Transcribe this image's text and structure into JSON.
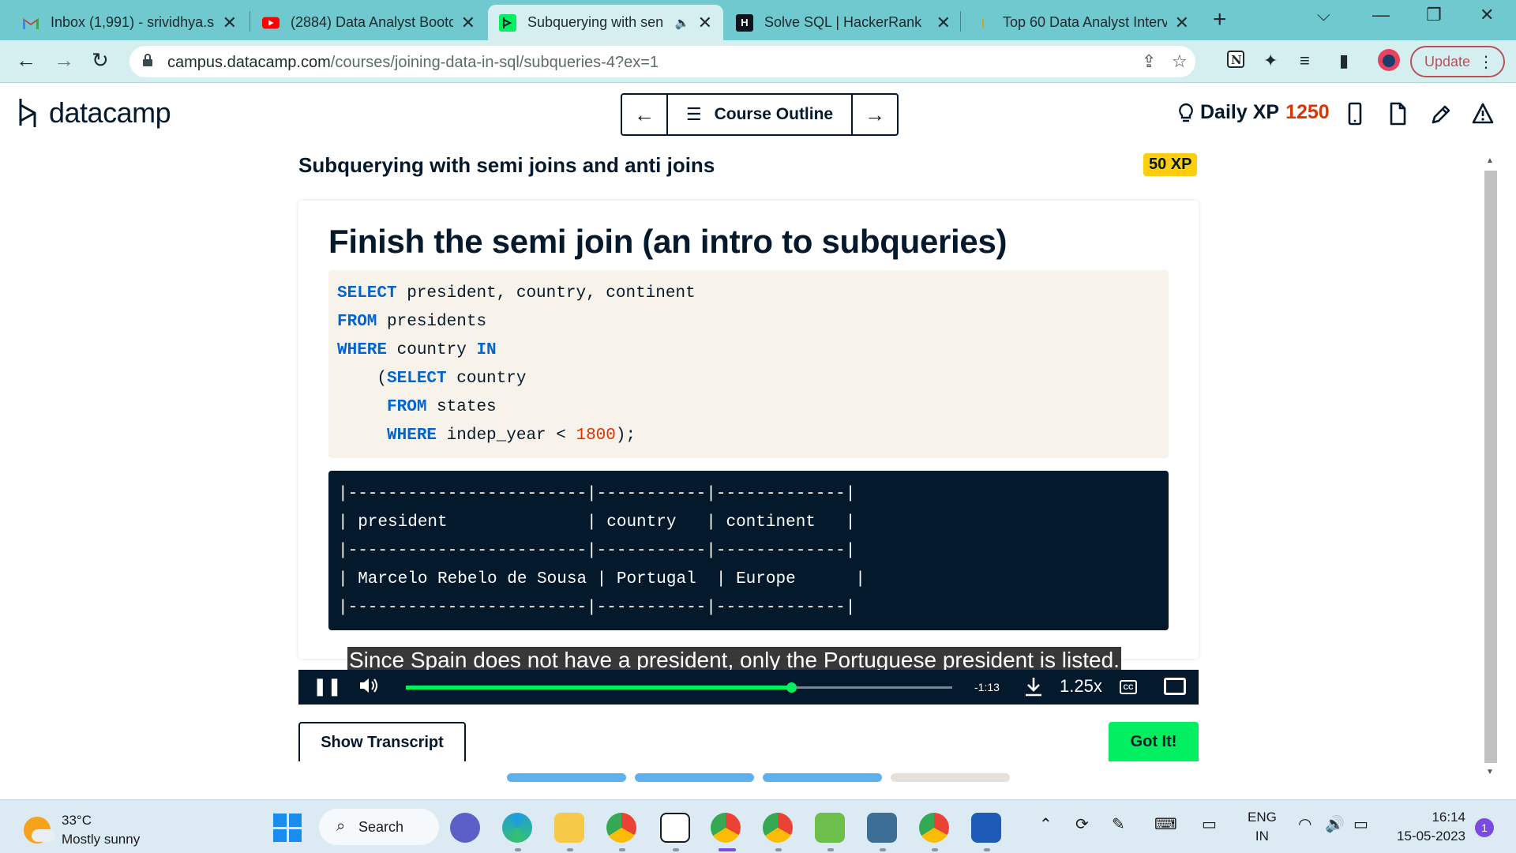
{
  "browser": {
    "tabs": [
      {
        "title": "Inbox (1,991) - srividhya.s",
        "icon": "gmail-icon"
      },
      {
        "title": "(2884) Data Analyst Bootc",
        "icon": "youtube-icon"
      },
      {
        "title": "Subquerying with sen",
        "icon": "datacamp-icon",
        "active": true
      },
      {
        "title": "Solve SQL | HackerRank",
        "icon": "hackerrank-icon"
      },
      {
        "title": "Top 60 Data Analyst Interv",
        "icon": "page-icon"
      }
    ],
    "url_host": "campus.datacamp.com",
    "url_path": "/courses/joining-data-in-sql/subqueries-4?ex=1",
    "update_label": "Update"
  },
  "app": {
    "logo_text": "datacamp",
    "course_outline_label": "Course Outline",
    "daily_xp_label": "Daily XP",
    "daily_xp_value": "1250",
    "lesson_title": "Subquerying with semi joins and anti joins",
    "xp_badge": "50 XP",
    "slide_title": "Finish the semi join (an intro to subqueries)",
    "caption": "Since Spain does not have a president, only the Portuguese president is listed.",
    "result_lines": [
      "|------------------------|-----------|-------------|",
      "| president              | country   | continent   |",
      "|------------------------|-----------|-------------|",
      "| Marcelo Rebelo de Sousa | Portugal  | Europe      |",
      "|------------------------|-----------|-------------|"
    ],
    "player": {
      "time_remaining": "-1:13",
      "playback_rate": "1.25x",
      "cc_label": "CC",
      "progress": 0.705
    },
    "show_transcript_label": "Show Transcript",
    "got_it_label": "Got It!",
    "progress_dots": [
      true,
      true,
      true,
      false
    ],
    "colors": {
      "accent_green": "#03ef62",
      "navy": "#05192d",
      "xp_orange": "#dd3400",
      "badge_yellow": "#fcce0d"
    }
  },
  "taskbar": {
    "temperature": "33°C",
    "weather": "Mostly sunny",
    "search_label": "Search",
    "lang_line1": "ENG",
    "lang_line2": "IN",
    "time": "16:14",
    "date": "15-05-2023",
    "notifications": "1"
  }
}
